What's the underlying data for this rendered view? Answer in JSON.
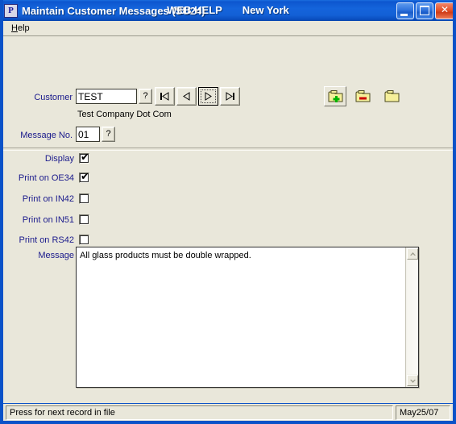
{
  "window": {
    "title": "Maintain Customer Messages (SU24)",
    "app_icon_letter": "P",
    "title_center_left": "WEB HELP",
    "title_center_right": "New York",
    "minimize_label": "Minimize",
    "maximize_label": "Maximize",
    "close_label": "Close",
    "close_glyph": "✕"
  },
  "menubar": {
    "items": [
      {
        "label": "Help",
        "accelerator": "H"
      }
    ]
  },
  "form": {
    "customer": {
      "label": "Customer",
      "value": "TEST",
      "lookup_label": "?",
      "company_name": "Test Company Dot Com"
    },
    "message_no": {
      "label": "Message No.",
      "value": "01",
      "lookup_label": "?"
    },
    "nav_buttons": [
      {
        "name": "first-record",
        "icon": "first"
      },
      {
        "name": "previous-record",
        "icon": "previous"
      },
      {
        "name": "next-record",
        "icon": "next",
        "focused": true
      },
      {
        "name": "last-record",
        "icon": "last"
      }
    ],
    "toolbar": [
      {
        "name": "add-record",
        "icon": "folder-add",
        "pressed": true
      },
      {
        "name": "delete-record",
        "icon": "folder-delete",
        "pressed": false
      },
      {
        "name": "open-record",
        "icon": "folder-open",
        "pressed": false
      }
    ],
    "checkboxes": [
      {
        "label": "Display",
        "checked": true
      },
      {
        "label": "Print on OE34",
        "checked": true
      },
      {
        "label": "Print on IN42",
        "checked": false
      },
      {
        "label": "Print on IN51",
        "checked": false
      },
      {
        "label": "Print on RS42",
        "checked": false
      }
    ],
    "message": {
      "label": "Message",
      "value": "All glass products must be double wrapped."
    }
  },
  "statusbar": {
    "message": "Press for next record in file",
    "date": "May25/07"
  },
  "colors": {
    "title_blue": "#0a52c8",
    "window_bg": "#e9e7da",
    "label_navy": "#1a1a8c",
    "folder_yellow": "#f5ef9a",
    "add_green": "#00b400",
    "delete_red": "#cc0000"
  }
}
